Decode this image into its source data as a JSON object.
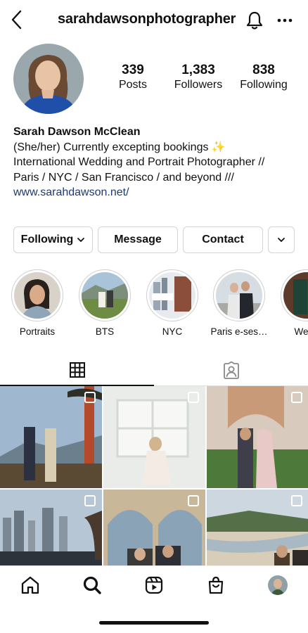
{
  "header": {
    "username": "sarahdawsonphotographer",
    "back_icon": "chevron-left-icon",
    "notifications_icon": "bell-icon",
    "menu_icon": "more-icon"
  },
  "profile": {
    "stats": {
      "posts_count": "339",
      "posts_label": "Posts",
      "followers_count": "1,383",
      "followers_label": "Followers",
      "following_count": "838",
      "following_label": "Following"
    },
    "name": "Sarah Dawson McClean",
    "bio_line1": "(She/her) Currently excepting bookings ✨",
    "bio_line2": "International Wedding and Portrait Photographer //",
    "bio_line3": "Paris / NYC / San Francisco / and beyond ///",
    "website": "www.sarahdawson.net/"
  },
  "actions": {
    "following_label": "Following",
    "message_label": "Message",
    "contact_label": "Contact"
  },
  "highlights": [
    {
      "label": "Portraits"
    },
    {
      "label": "BTS"
    },
    {
      "label": "NYC"
    },
    {
      "label": "Paris e-ses…"
    },
    {
      "label": "Wedd"
    }
  ],
  "tabs": {
    "grid_icon": "grid-icon",
    "tagged_icon": "tagged-user-icon"
  },
  "bottom_nav": [
    "home-icon",
    "search-icon",
    "reels-icon",
    "shop-icon",
    "profile-avatar"
  ],
  "colors": {
    "link": "#1d3b72",
    "border": "#d4d4d4"
  }
}
